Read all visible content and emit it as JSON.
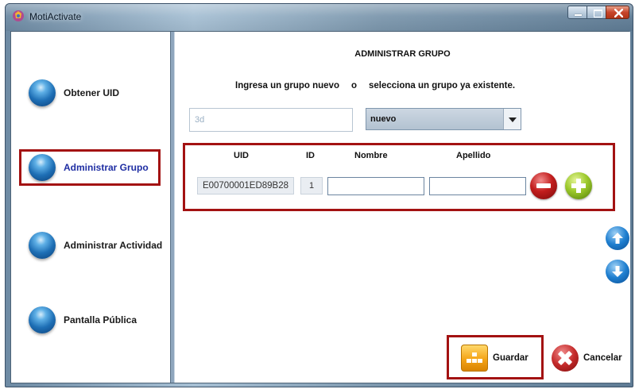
{
  "window": {
    "title": "MotiActivate"
  },
  "sidebar": {
    "items": [
      {
        "label": "Obtener UID"
      },
      {
        "label": "Administrar Grupo",
        "active": true
      },
      {
        "label": "Administrar Actividad"
      },
      {
        "label": "Pantalla Pública"
      }
    ]
  },
  "main": {
    "heading": "ADMINISTRAR GRUPO",
    "instruction_left": "Ingresa un grupo nuevo",
    "instruction_or": "o",
    "instruction_right": "selecciona un grupo ya existente.",
    "group_input_value": "3d",
    "group_select_value": "nuevo",
    "table": {
      "headers": {
        "uid": "UID",
        "id": "ID",
        "nombre": "Nombre",
        "apellido": "Apellido"
      },
      "rows": [
        {
          "uid": "E00700001ED89B28",
          "id": "1",
          "nombre": "",
          "apellido": ""
        }
      ]
    },
    "buttons": {
      "save": "Guardar",
      "cancel": "Cancelar"
    }
  },
  "icons": {
    "remove_row": "minus-circle-icon",
    "add_row": "plus-circle-icon",
    "move_up": "arrow-up-circle-icon",
    "move_down": "arrow-down-circle-icon",
    "save": "save-icon",
    "cancel": "x-circle-icon",
    "nav": "blue-orb-icon"
  },
  "colors": {
    "highlight": "#a31212",
    "active_nav_text": "#1f2ea3",
    "select_bg": "#b3c2d1"
  }
}
